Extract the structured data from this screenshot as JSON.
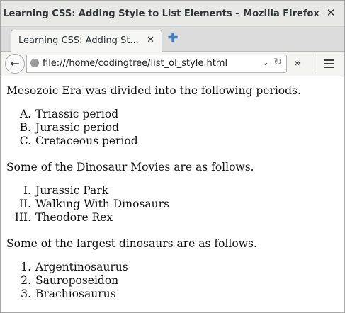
{
  "window": {
    "title": "Learning CSS: Adding Style to List Elements – Mozilla Firefox",
    "close_glyph": "✕"
  },
  "tabs": [
    {
      "label": "Learning CSS: Adding St...",
      "close_glyph": "✕"
    }
  ],
  "new_tab_glyph": "✚",
  "nav": {
    "back_glyph": "←",
    "url": "file:///home/codingtree/list_ol_style.html",
    "dropdown_glyph": "⌄",
    "reload_glyph": "↻",
    "overflow_glyph": "»"
  },
  "content": {
    "intro1": "Mesozoic Era was divided into the following periods.",
    "list1": {
      "style": "upper-alpha",
      "items": [
        {
          "marker": "A.",
          "text": "Triassic period"
        },
        {
          "marker": "B.",
          "text": "Jurassic period"
        },
        {
          "marker": "C.",
          "text": "Cretaceous period"
        }
      ]
    },
    "intro2": "Some of the Dinosaur Movies are as follows.",
    "list2": {
      "style": "upper-roman",
      "items": [
        {
          "marker": "I.",
          "text": "Jurassic Park"
        },
        {
          "marker": "II.",
          "text": "Walking With Dinosaurs"
        },
        {
          "marker": "III.",
          "text": "Theodore Rex"
        }
      ]
    },
    "intro3": "Some of the largest dinosaurs are as follows.",
    "list3": {
      "style": "decimal",
      "items": [
        {
          "marker": "1.",
          "text": "Argentinosaurus"
        },
        {
          "marker": "2.",
          "text": "Sauroposeidon"
        },
        {
          "marker": "3.",
          "text": "Brachiosaurus"
        }
      ]
    }
  }
}
